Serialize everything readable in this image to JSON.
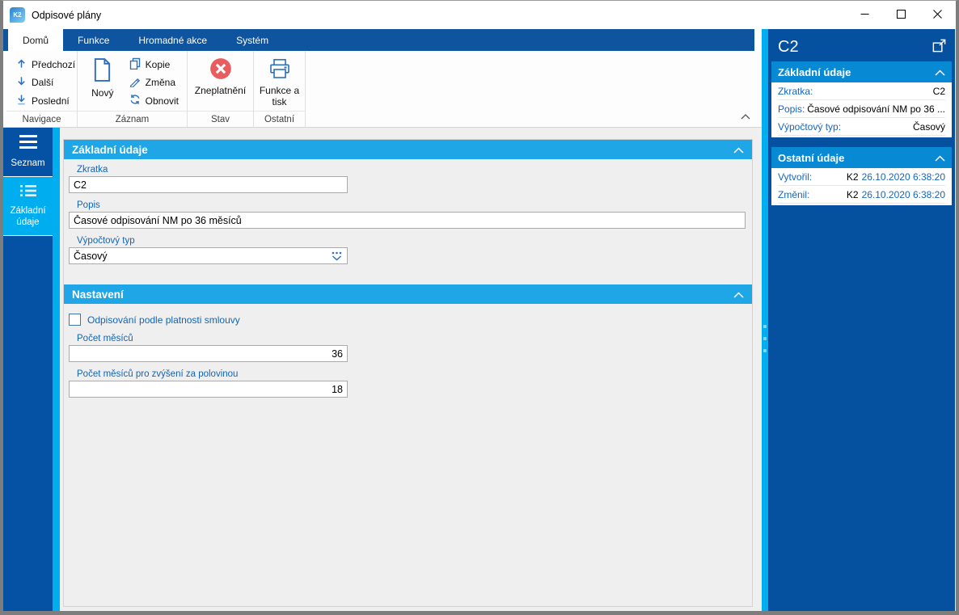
{
  "window": {
    "title": "Odpisové plány",
    "app_icon_text": "K2"
  },
  "tabs": [
    {
      "label": "Domů",
      "active": true
    },
    {
      "label": "Funkce",
      "active": false
    },
    {
      "label": "Hromadné akce",
      "active": false
    },
    {
      "label": "Systém",
      "active": false
    }
  ],
  "ribbon": {
    "groups": [
      {
        "label": "Navigace",
        "items": [
          {
            "label": "Předchozí",
            "icon": "arrow-up-icon"
          },
          {
            "label": "Další",
            "icon": "arrow-down-icon"
          },
          {
            "label": "Poslední",
            "icon": "arrow-down-last-icon"
          }
        ]
      },
      {
        "label": "Záznam",
        "big": {
          "label": "Nový",
          "icon": "new-document-icon"
        },
        "items": [
          {
            "label": "Kopie",
            "icon": "copy-icon"
          },
          {
            "label": "Změna",
            "icon": "pencil-icon"
          },
          {
            "label": "Obnovit",
            "icon": "refresh-icon"
          }
        ]
      },
      {
        "label": "Stav",
        "big": {
          "label": "Zneplatnění",
          "icon": "invalidate-icon"
        }
      },
      {
        "label": "Ostatní",
        "big": {
          "label": "Funkce a tisk",
          "icon": "printer-icon"
        }
      }
    ]
  },
  "sidebar": {
    "items": [
      {
        "label": "Seznam",
        "icon": "menu-icon",
        "active": false
      },
      {
        "label": "Základní údaje",
        "icon": "list-icon",
        "active": true
      }
    ]
  },
  "form": {
    "sections": [
      {
        "title": "Základní údaje",
        "fields": [
          {
            "label": "Zkratka",
            "value": "C2",
            "type": "text"
          },
          {
            "label": "Popis",
            "value": "Časové odpisování NM po 36 měsíců",
            "type": "text"
          },
          {
            "label": "Výpočtový typ",
            "value": "Časový",
            "type": "dropdown",
            "icon": "dropdown-icon"
          }
        ]
      },
      {
        "title": "Nastavení",
        "checkbox": {
          "label": "Odpisování podle platnosti smlouvy",
          "checked": false
        },
        "fields": [
          {
            "label": "Počet měsíců",
            "value": "36",
            "type": "number"
          },
          {
            "label": "Počet měsíců pro zvýšení za polovinou",
            "value": "18",
            "type": "number"
          }
        ]
      }
    ]
  },
  "panel": {
    "title": "C2",
    "popout_icon": "open-in-new-window-icon",
    "sections": [
      {
        "title": "Základní údaje",
        "rows": [
          {
            "label": "Zkratka:",
            "value": "C2"
          },
          {
            "label": "Popis:",
            "value": "Časové odpisování NM po 36 ..."
          },
          {
            "label": "Výpočtový typ:",
            "value": "Časový"
          }
        ]
      },
      {
        "title": "Ostatní údaje",
        "rows": [
          {
            "label": "Vytvořil:",
            "user": "K2",
            "datetime": "26.10.2020 6:38:20"
          },
          {
            "label": "Změnil:",
            "user": "K2",
            "datetime": "26.10.2020 6:38:20"
          }
        ]
      }
    ]
  },
  "colors": {
    "accent_cyan": "#00aeef",
    "dark_blue": "#0552a5",
    "tabbar_blue": "#0e549e",
    "section_header_blue": "#1ea6e6",
    "panel_section_header_blue": "#0889d4",
    "label_blue": "#1464b4",
    "link_blue": "#1565c0",
    "invalid_red": "#e85d5d"
  }
}
